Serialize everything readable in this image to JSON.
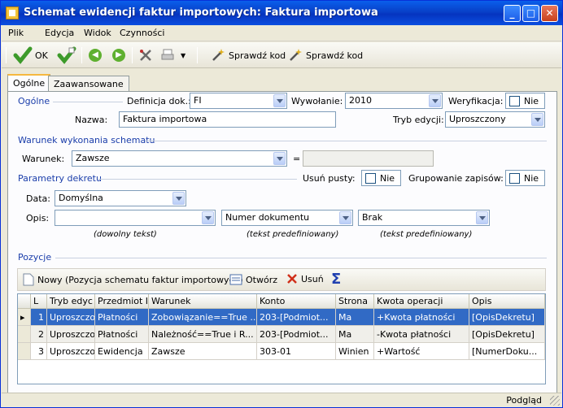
{
  "window": {
    "title": "Schemat ewidencji faktur importowych: Faktura importowa"
  },
  "menu": [
    "Plik",
    "Edycja",
    "Widok",
    "Czynności"
  ],
  "toolbar": {
    "ok_label": "OK",
    "check_code_1": "Sprawdź kod",
    "check_code_2": "Sprawdź kod"
  },
  "tabs": [
    "Ogólne",
    "Zaawansowane"
  ],
  "general": {
    "section": "Ogólne",
    "definition_label": "Definicja dok.:",
    "definition_value": "FI",
    "invocation_label": "Wywołanie:",
    "invocation_value": "2010",
    "verification_label": "Weryfikacja:",
    "verification_value": "Nie",
    "name_label": "Nazwa:",
    "name_value": "Faktura importowa",
    "edit_mode_label": "Tryb edycji:",
    "edit_mode_value": "Uproszczony"
  },
  "condition": {
    "section": "Warunek wykonania schematu",
    "label": "Warunek:",
    "value": "Zawsze",
    "equals": "="
  },
  "decree": {
    "section": "Parametry dekretu",
    "remove_empty_label": "Usuń pusty:",
    "remove_empty_value": "Nie",
    "grouping_label": "Grupowanie zapisów:",
    "grouping_value": "Nie",
    "date_label": "Data:",
    "date_value": "Domyślna",
    "desc_label": "Opis:",
    "desc_1": "",
    "desc_2": "Numer dokumentu",
    "desc_3": "Brak",
    "hint_1": "(dowolny tekst)",
    "hint_2": "(tekst predefiniowany)",
    "hint_3": "(tekst predefiniowany)"
  },
  "positions": {
    "section": "Pozycje",
    "new_label": "Nowy (Pozycja schematu faktur importowych)",
    "open_label": "Otwórz",
    "delete_label": "Usuń",
    "headers": [
      "L",
      "Tryb edyc",
      "Przedmiot I",
      "Warunek",
      "Konto",
      "Strona",
      "Kwota operacji",
      "Opis"
    ],
    "rows": [
      [
        "1",
        "Uproszczo",
        "Płatności",
        "Zobowiązanie==True ...",
        "203-[Podmiot...",
        "Ma",
        "+Kwota płatności",
        "[OpisDekretu]"
      ],
      [
        "2",
        "Uproszczo",
        "Płatności",
        "Należność==True i R...",
        "203-[Podmiot...",
        "Ma",
        "-Kwota płatności",
        "[OpisDekretu]"
      ],
      [
        "3",
        "Uproszczo",
        "Ewidencja",
        "Zawsze",
        "303-01",
        "Winien",
        "+Wartość",
        "[NumerDoku..."
      ]
    ]
  },
  "status": {
    "text": "Podgląd"
  }
}
